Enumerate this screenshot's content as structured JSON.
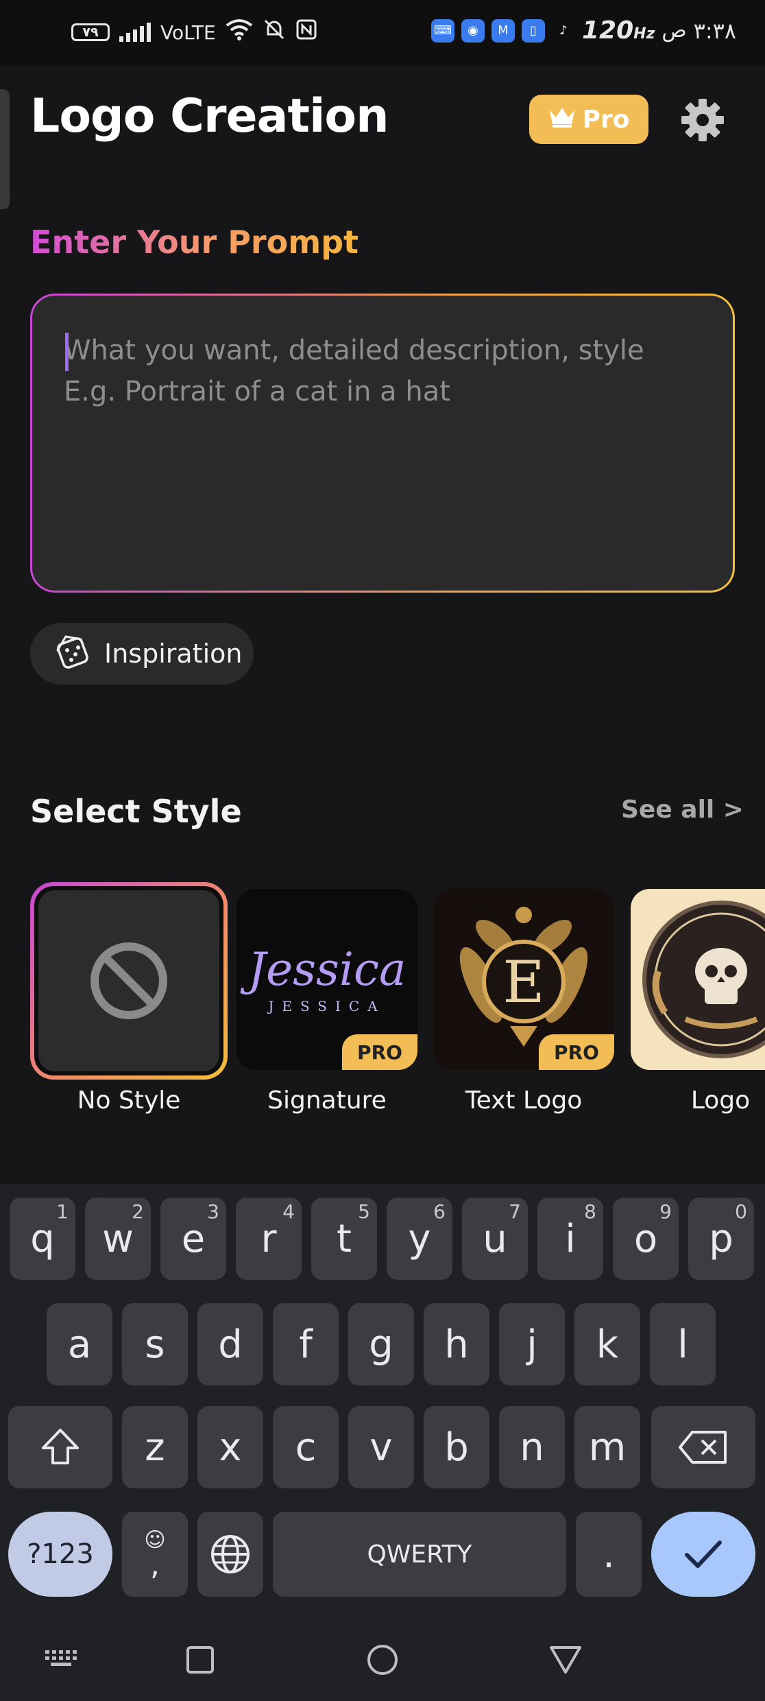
{
  "status_bar": {
    "battery": "٧٩",
    "network": "VoLTE",
    "refresh_rate": "120",
    "refresh_unit": "Hz",
    "time": "٣:٣٨",
    "ampm": "ص"
  },
  "header": {
    "title": "Logo Creation",
    "pro_label": "Pro"
  },
  "prompt": {
    "section_title": "Enter Your Prompt",
    "placeholder_line1": "What you want, detailed description, style",
    "placeholder_line2": "E.g. Portrait of a cat in a hat",
    "inspiration_label": "Inspiration"
  },
  "styles": {
    "section_title": "Select Style",
    "see_all": "See all >",
    "items": [
      {
        "label": "No Style",
        "selected": true,
        "pro": false
      },
      {
        "label": "Signature",
        "selected": false,
        "pro": true,
        "badge": "PRO",
        "art_text": "Jessica",
        "art_sub": "JESSICA"
      },
      {
        "label": "Text Logo",
        "selected": false,
        "pro": true,
        "badge": "PRO",
        "art_text": "E"
      },
      {
        "label": "Logo",
        "selected": false,
        "pro": false
      }
    ]
  },
  "keyboard": {
    "row1": [
      {
        "k": "q",
        "n": "1"
      },
      {
        "k": "w",
        "n": "2"
      },
      {
        "k": "e",
        "n": "3"
      },
      {
        "k": "r",
        "n": "4"
      },
      {
        "k": "t",
        "n": "5"
      },
      {
        "k": "y",
        "n": "6"
      },
      {
        "k": "u",
        "n": "7"
      },
      {
        "k": "i",
        "n": "8"
      },
      {
        "k": "o",
        "n": "9"
      },
      {
        "k": "p",
        "n": "0"
      }
    ],
    "row2": [
      "a",
      "s",
      "d",
      "f",
      "g",
      "h",
      "j",
      "k",
      "l"
    ],
    "row3": [
      "z",
      "x",
      "c",
      "v",
      "b",
      "n",
      "m"
    ],
    "symbols_label": "?123",
    "comma_label": ",",
    "space_label": "QWERTY",
    "period_label": "."
  },
  "colors": {
    "accent_gold": "#f3bd56",
    "gradient_start": "#c846d6",
    "gradient_end": "#f4bf3c",
    "background": "#161618"
  }
}
